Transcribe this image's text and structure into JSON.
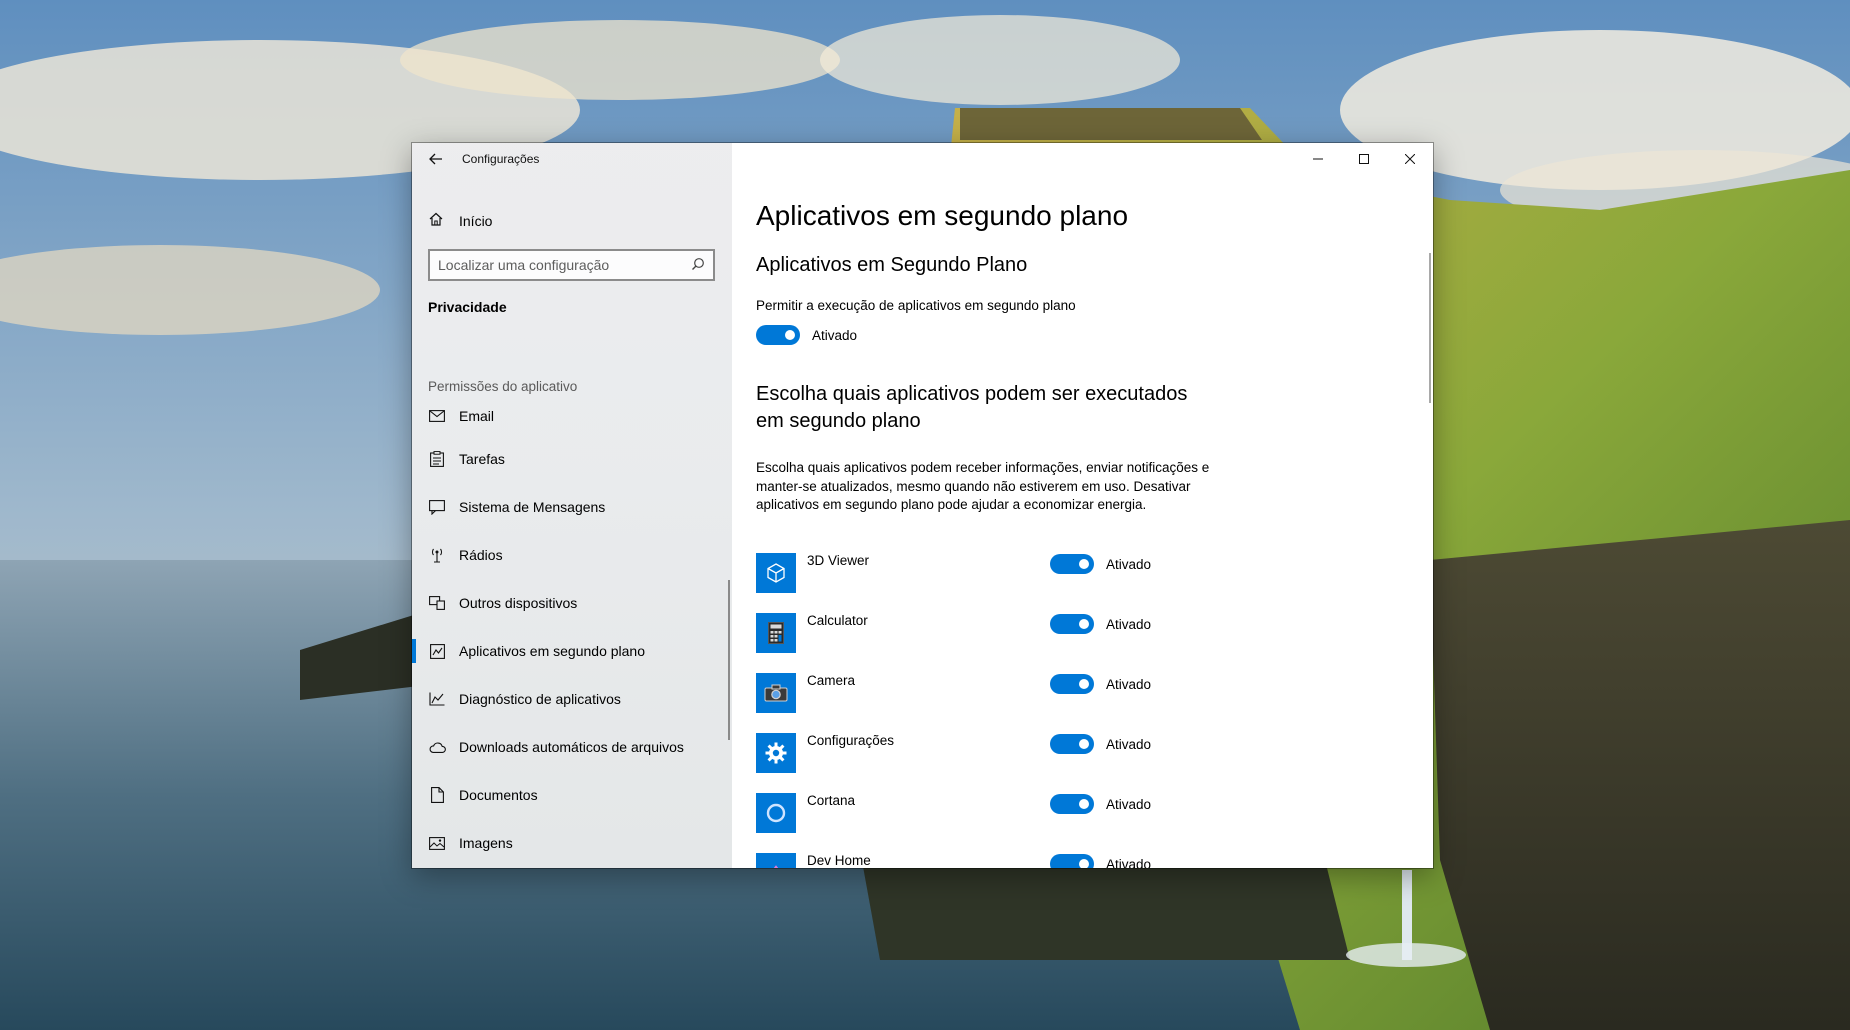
{
  "window": {
    "title": "Configurações",
    "back_icon": "arrow-left-icon",
    "caption": {
      "minimize": "minimize-icon",
      "maximize": "maximize-icon",
      "close": "close-icon"
    }
  },
  "sidebar": {
    "home_label": "Início",
    "search_placeholder": "Localizar uma configuração",
    "category": "Privacidade",
    "group_header": "Permissões do aplicativo",
    "items": [
      {
        "label": "Email",
        "icon": "mail-icon",
        "selected": false
      },
      {
        "label": "Tarefas",
        "icon": "tasks-icon",
        "selected": false
      },
      {
        "label": "Sistema de Mensagens",
        "icon": "messaging-icon",
        "selected": false
      },
      {
        "label": "Rádios",
        "icon": "radio-tower-icon",
        "selected": false
      },
      {
        "label": "Outros dispositivos",
        "icon": "devices-icon",
        "selected": false
      },
      {
        "label": "Aplicativos em segundo plano",
        "icon": "background-apps-icon",
        "selected": true
      },
      {
        "label": "Diagnóstico de aplicativos",
        "icon": "diagnostics-icon",
        "selected": false
      },
      {
        "label": "Downloads automáticos de arquivos",
        "icon": "cloud-icon",
        "selected": false
      },
      {
        "label": "Documentos",
        "icon": "document-icon",
        "selected": false
      },
      {
        "label": "Imagens",
        "icon": "image-icon",
        "selected": false
      }
    ]
  },
  "main": {
    "page_title": "Aplicativos em segundo plano",
    "section_title": "Aplicativos em Segundo Plano",
    "allow_label": "Permitir a execução de aplicativos em segundo plano",
    "allow_state": "Ativado",
    "section2_title": "Escolha quais aplicativos podem ser executados em segundo plano",
    "description": "Escolha quais aplicativos podem receber informações, enviar notificações e manter-se atualizados, mesmo quando não estiverem em uso. Desativar aplicativos em segundo plano pode ajudar a economizar energia.",
    "apps": [
      {
        "name": "3D Viewer",
        "state": "Ativado",
        "icon": "cube-icon"
      },
      {
        "name": "Calculator",
        "state": "Ativado",
        "icon": "calculator-icon"
      },
      {
        "name": "Camera",
        "state": "Ativado",
        "icon": "camera-icon"
      },
      {
        "name": "Configurações",
        "state": "Ativado",
        "icon": "gear-icon"
      },
      {
        "name": "Cortana",
        "state": "Ativado",
        "icon": "cortana-ring-icon"
      },
      {
        "name": "Dev Home",
        "state": "Ativado",
        "icon": "dev-home-icon"
      }
    ]
  },
  "colors": {
    "accent": "#0078d7"
  }
}
